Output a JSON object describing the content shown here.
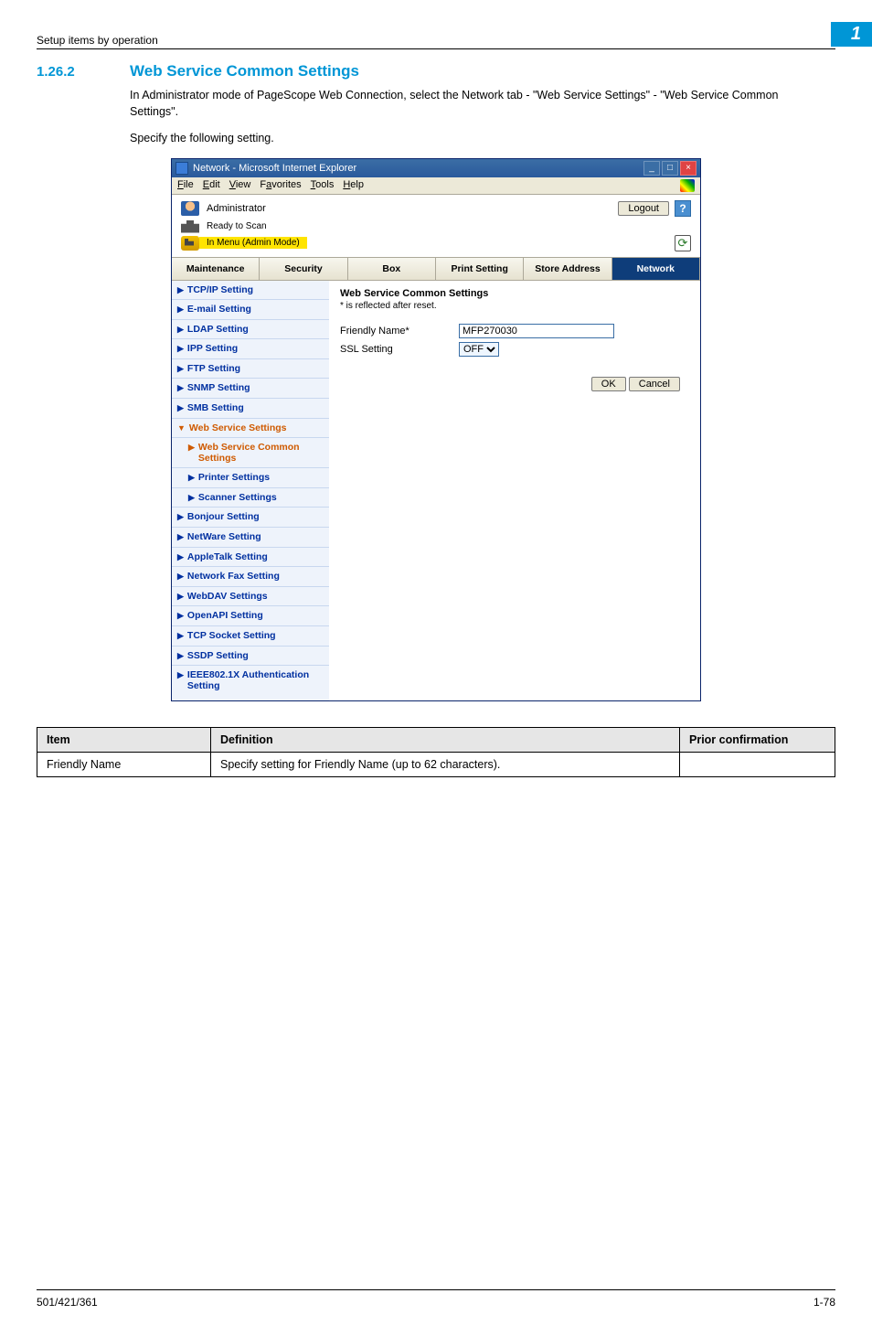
{
  "header": {
    "section_label": "Setup items by operation",
    "chapter_badge": "1"
  },
  "section": {
    "number": "1.26.2",
    "title": "Web Service Common Settings",
    "paragraph1": "In Administrator mode of PageScope Web Connection, select the Network tab - \"Web Service Settings\" - \"Web Service Common Settings\".",
    "paragraph2": "Specify the following setting."
  },
  "ie": {
    "title": "Network - Microsoft Internet Explorer",
    "menus": {
      "file": "File",
      "edit": "Edit",
      "view": "View",
      "favorites": "Favorites",
      "tools": "Tools",
      "help": "Help"
    },
    "admin_label": "Administrator",
    "logout_label": "Logout",
    "status_text": "Ready to Scan",
    "mode_text": "In Menu (Admin Mode)",
    "tabs": {
      "maintenance": "Maintenance",
      "security": "Security",
      "box": "Box",
      "print": "Print Setting",
      "store": "Store Address",
      "network": "Network"
    }
  },
  "sidebar": {
    "items": [
      {
        "label": "TCP/IP Setting"
      },
      {
        "label": "E-mail Setting"
      },
      {
        "label": "LDAP Setting"
      },
      {
        "label": "IPP Setting"
      },
      {
        "label": "FTP Setting"
      },
      {
        "label": "SNMP Setting"
      },
      {
        "label": "SMB Setting"
      },
      {
        "label": "Web Service Settings"
      },
      {
        "label": "Web Service Common Settings"
      },
      {
        "label": "Printer Settings"
      },
      {
        "label": "Scanner Settings"
      },
      {
        "label": "Bonjour Setting"
      },
      {
        "label": "NetWare Setting"
      },
      {
        "label": "AppleTalk Setting"
      },
      {
        "label": "Network Fax Setting"
      },
      {
        "label": "WebDAV Settings"
      },
      {
        "label": "OpenAPI Setting"
      },
      {
        "label": "TCP Socket Setting"
      },
      {
        "label": "SSDP Setting"
      },
      {
        "label": "IEEE802.1X Authentication Setting"
      }
    ]
  },
  "panel": {
    "heading": "Web Service Common Settings",
    "note": "* is reflected after reset.",
    "friendly_label": "Friendly Name*",
    "friendly_value": "MFP270030",
    "ssl_label": "SSL Setting",
    "ssl_value": "OFF",
    "ok_label": "OK",
    "cancel_label": "Cancel"
  },
  "def_table": {
    "head": {
      "c1": "Item",
      "c2": "Definition",
      "c3": "Prior confirmation"
    },
    "rows": [
      {
        "item": "Friendly Name",
        "def": "Specify setting for Friendly Name (up to 62 characters).",
        "prior": ""
      }
    ]
  },
  "footer": {
    "left": "501/421/361",
    "right": "1-78"
  }
}
